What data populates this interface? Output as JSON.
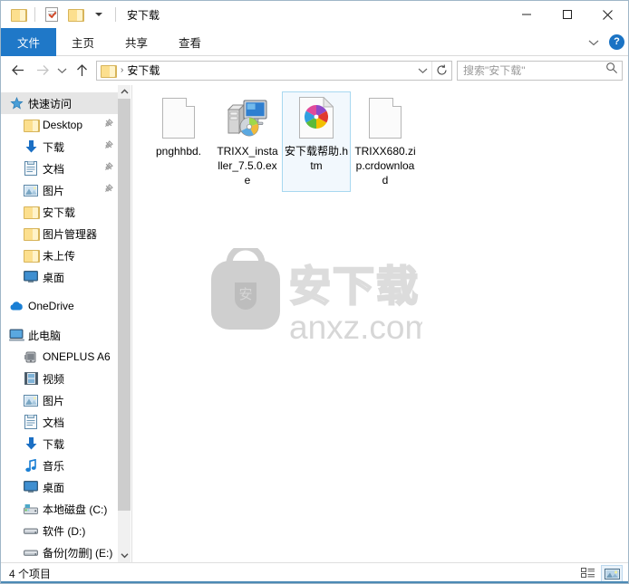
{
  "window": {
    "title": "安下载",
    "quick_access_toolbar": [
      {
        "name": "folder-properties-icon",
        "label": "属性"
      },
      {
        "name": "new-folder-icon",
        "label": "新建文件夹"
      },
      {
        "name": "customize-qat-caret",
        "label": "自定义快速访问工具栏"
      }
    ],
    "controls": {
      "minimize": "最小化",
      "maximize": "最大化",
      "close": "关闭"
    }
  },
  "ribbon": {
    "tabs": [
      {
        "label": "文件",
        "selected": true
      },
      {
        "label": "主页",
        "selected": false
      },
      {
        "label": "共享",
        "selected": false
      },
      {
        "label": "查看",
        "selected": false
      }
    ],
    "collapse_label": "展开功能区",
    "help_label": "?"
  },
  "nav": {
    "back": "后退",
    "forward": "前进",
    "recent": "最近访问的位置",
    "up": "上移一级",
    "breadcrumb": {
      "folder_icon": "folder-icon",
      "separator": "›",
      "path": "安下载"
    },
    "address_dropdown": "历史记录",
    "refresh": "刷新",
    "search": {
      "placeholder": "搜索\"安下载\"",
      "icon": "search-icon"
    }
  },
  "sidebar": {
    "items": [
      {
        "label": "快速访问",
        "icon": "star-pin-icon",
        "level": 0,
        "selected": true,
        "pinned": false
      },
      {
        "label": "Desktop",
        "icon": "folder-icon",
        "level": 1,
        "selected": false,
        "pinned": true
      },
      {
        "label": "下载",
        "icon": "download-arrow-icon",
        "level": 1,
        "selected": false,
        "pinned": true
      },
      {
        "label": "文档",
        "icon": "documents-icon",
        "level": 1,
        "selected": false,
        "pinned": true
      },
      {
        "label": "图片",
        "icon": "pictures-icon",
        "level": 1,
        "selected": false,
        "pinned": true
      },
      {
        "label": "安下载",
        "icon": "folder-icon",
        "level": 1,
        "selected": false,
        "pinned": false
      },
      {
        "label": "图片管理器",
        "icon": "folder-icon",
        "level": 1,
        "selected": false,
        "pinned": false
      },
      {
        "label": "未上传",
        "icon": "folder-icon",
        "level": 1,
        "selected": false,
        "pinned": false
      },
      {
        "label": "桌面",
        "icon": "desktop-monitor-icon",
        "level": 1,
        "selected": false,
        "pinned": false
      },
      {
        "label": "OneDrive",
        "icon": "onedrive-cloud-icon",
        "level": 0,
        "selected": false,
        "pinned": false,
        "gap_before": true
      },
      {
        "label": "此电脑",
        "icon": "this-pc-icon",
        "level": 0,
        "selected": false,
        "pinned": false,
        "gap_before": true
      },
      {
        "label": "ONEPLUS A6",
        "icon": "phone-device-icon",
        "level": 1,
        "selected": false,
        "pinned": false
      },
      {
        "label": "视频",
        "icon": "videos-icon",
        "level": 1,
        "selected": false,
        "pinned": false
      },
      {
        "label": "图片",
        "icon": "pictures-icon",
        "level": 1,
        "selected": false,
        "pinned": false
      },
      {
        "label": "文档",
        "icon": "documents-icon",
        "level": 1,
        "selected": false,
        "pinned": false
      },
      {
        "label": "下载",
        "icon": "download-arrow-icon",
        "level": 1,
        "selected": false,
        "pinned": false
      },
      {
        "label": "音乐",
        "icon": "music-note-icon",
        "level": 1,
        "selected": false,
        "pinned": false
      },
      {
        "label": "桌面",
        "icon": "desktop-monitor-icon",
        "level": 1,
        "selected": false,
        "pinned": false
      },
      {
        "label": "本地磁盘 (C:)",
        "icon": "system-drive-icon",
        "level": 1,
        "selected": false,
        "pinned": false
      },
      {
        "label": "软件 (D:)",
        "icon": "hard-drive-icon",
        "level": 1,
        "selected": false,
        "pinned": false
      },
      {
        "label": "备份[勿删] (E:)",
        "icon": "drive-icon",
        "level": 1,
        "selected": false,
        "pinned": false
      }
    ],
    "scroll_up": "向上滚动",
    "scroll_down": "向下滚动"
  },
  "files": [
    {
      "name": "pnghhbd.",
      "icon": "blank-document-icon",
      "selected": false
    },
    {
      "name": "TRIXX_installer_7.5.0.exe",
      "icon": "installer-setup-icon",
      "selected": false
    },
    {
      "name": "安下载帮助.htm",
      "icon": "chrome-html-document-icon",
      "selected": true
    },
    {
      "name": "TRIXX680.zip.crdownload",
      "icon": "blank-document-icon",
      "selected": false
    }
  ],
  "watermark": {
    "brand": "安下载",
    "domain": "anxz.com",
    "logo_glyph": "安"
  },
  "statusbar": {
    "item_count": "4 个项目",
    "views": [
      {
        "name": "details-view-button",
        "label": "详细信息",
        "active": false
      },
      {
        "name": "large-icons-view-button",
        "label": "大图标",
        "active": true
      }
    ]
  },
  "colors": {
    "accent": "#1f78c8",
    "selection_fill": "#f2f8fd",
    "selection_border": "#a8d8f0",
    "folder_yellow": "#fcdf8e",
    "bottom_rule": "#4c8ab5"
  }
}
